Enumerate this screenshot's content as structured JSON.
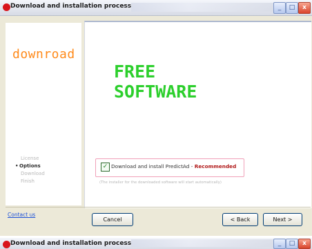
{
  "window": {
    "title": "Download and installation process",
    "minimize_glyph": "_",
    "maximize_glyph": "□",
    "close_glyph": "x",
    "close_color": "#d9432b"
  },
  "sidebar": {
    "brand_word": "downroad",
    "steps": [
      {
        "label": "License",
        "active": false
      },
      {
        "label": "Options",
        "active": true
      },
      {
        "label": "Download",
        "active": false
      },
      {
        "label": "Finish",
        "active": false
      }
    ],
    "bullet": "•"
  },
  "main": {
    "headline_line1": "FREE",
    "headline_line2": "SOFTWARE",
    "headline_color": "#2ccf2c",
    "option": {
      "checked": true,
      "check_glyph": "✓",
      "label": "Download and install PredictAd - ",
      "label_emphasis": "Recommended"
    },
    "note": "(The installer for the downloaded software will start automatically)"
  },
  "footer": {
    "contact": "Contact us",
    "cancel": "Cancel",
    "back": "< Back",
    "next": "Next >"
  },
  "second_window": {
    "title": "Download and installation process"
  }
}
